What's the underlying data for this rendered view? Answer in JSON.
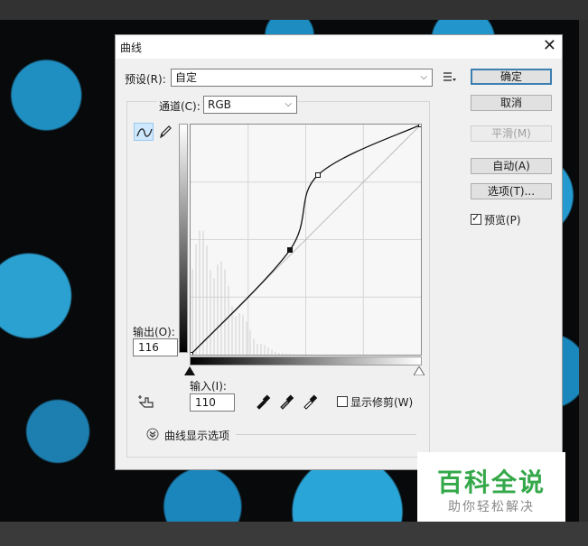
{
  "dialog": {
    "title": "曲线",
    "preset_label": "预设(R):",
    "preset_value": "自定",
    "channel_label": "通道(C):",
    "channel_value": "RGB",
    "output_label": "输出(O):",
    "output_value": "116",
    "input_label": "输入(I):",
    "input_value": "110",
    "show_clipping_label": "显示修剪(W)",
    "curve_display_options_label": "曲线显示选项",
    "preview_label": "预览(P)",
    "preview_checked": true,
    "show_clipping_checked": false
  },
  "buttons": {
    "ok": "确定",
    "cancel": "取消",
    "smooth": "平滑(M)",
    "auto": "自动(A)",
    "options": "选项(T)..."
  },
  "icons": {
    "close": "close-icon",
    "preset_menu": "preset-menu-icon",
    "curve_tool": "curve-point-tool-icon",
    "pencil_tool": "pencil-tool-icon",
    "hand_tool": "targeted-adjustment-hand-icon",
    "eyedropper_black": "eyedropper-black-icon",
    "eyedropper_gray": "eyedropper-gray-icon",
    "eyedropper_white": "eyedropper-white-icon",
    "expand": "expand-chevron-icon"
  },
  "curve": {
    "points": [
      [
        0,
        0
      ],
      [
        110,
        116
      ],
      [
        141,
        199
      ],
      [
        255,
        255
      ]
    ],
    "range": [
      0,
      255
    ]
  },
  "watermark": {
    "title": "百科全说",
    "subtitle": "助你轻松解决"
  },
  "colors": {
    "accent": "#3c7fb1",
    "watermark_green": "#35a84a"
  }
}
